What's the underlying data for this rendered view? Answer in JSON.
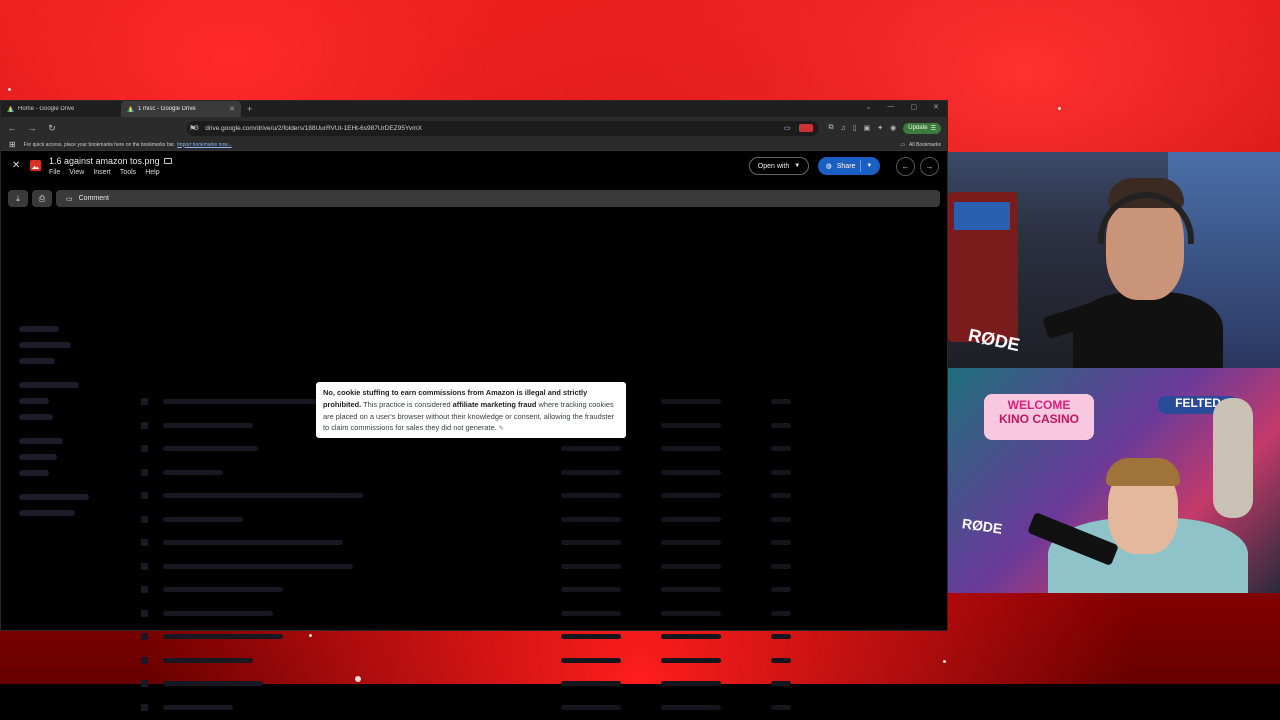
{
  "browser": {
    "tabs": [
      {
        "label": "Home - Google Drive",
        "active": false
      },
      {
        "label": "1 misc - Google Drive",
        "active": true
      }
    ],
    "url": "drive.google.com/drive/u/2/folders/188UurRVUt-1EHt-6s987UrDEZ95YvmX",
    "bookmarks_hint": "For quick access, place your bookmarks here on the bookmarks bar.",
    "import_link": "Import bookmarks now...",
    "all_bookmarks": "All Bookmarks",
    "update_label": "Update"
  },
  "viewer": {
    "file_title": "1.6 against amazon tos.png",
    "menu": [
      "File",
      "View",
      "Insert",
      "Tools",
      "Help"
    ],
    "open_with": "Open with",
    "share": "Share",
    "comment": "Comment"
  },
  "popup": {
    "bold1": "No, cookie stuffing to earn commissions from Amazon is illegal and strictly prohibited.",
    "text1": " This practice is considered ",
    "bold2": "affiliate marketing fraud",
    "text2": " where tracking cookies are placed on a user's browser without their knowledge or consent, allowing the fraudster to claim commissions for sales they did not generate."
  },
  "webcam": {
    "mic_brand": "RØDE",
    "sign_welcome": "WELCOME",
    "sign_casino": "KINO CASINO",
    "sign_felted": "FELTED"
  },
  "colors": {
    "share_blue": "#1a5fc4",
    "update_green": "#3d7a3d",
    "backdrop_red": "#b00000"
  }
}
